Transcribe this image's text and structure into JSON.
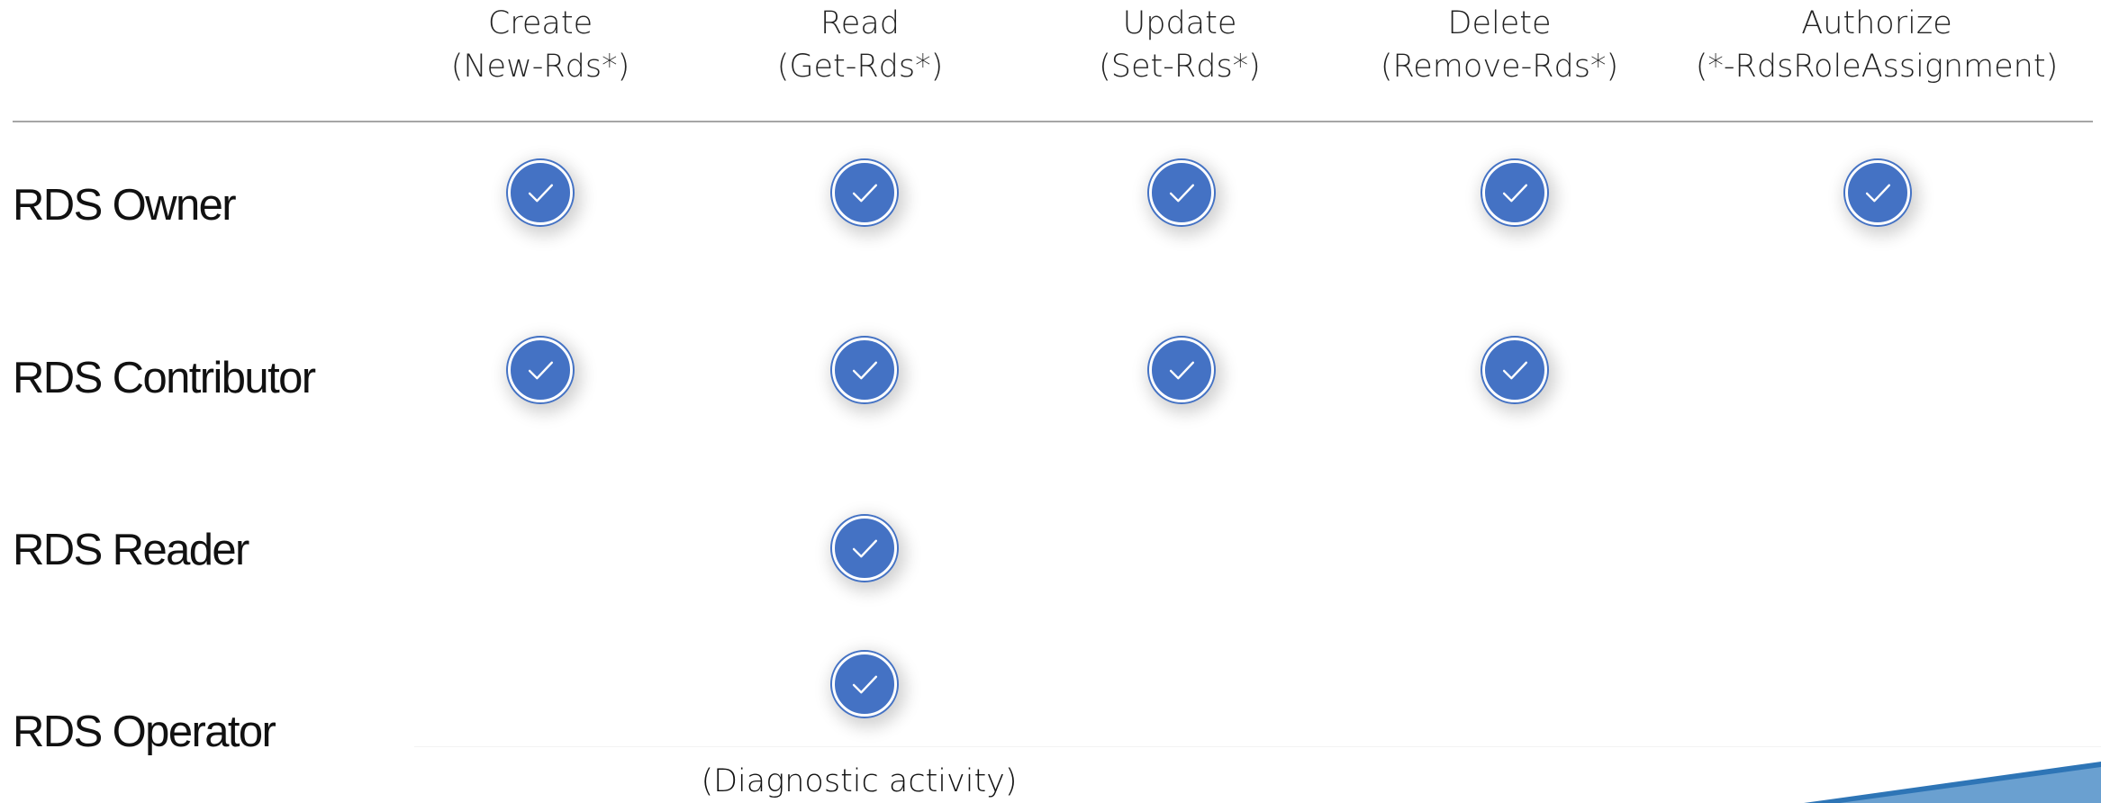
{
  "columns": [
    {
      "title": "Create",
      "subtitle": "(New-Rds*)"
    },
    {
      "title": "Read",
      "subtitle": "(Get-Rds*)"
    },
    {
      "title": "Update",
      "subtitle": "(Set-Rds*)"
    },
    {
      "title": "Delete",
      "subtitle": "(Remove-Rds*)"
    },
    {
      "title": "Authorize",
      "subtitle": "(*-RdsRoleAssignment)"
    }
  ],
  "rows": [
    {
      "label": "RDS Owner",
      "permissions": [
        true,
        true,
        true,
        true,
        true
      ]
    },
    {
      "label": "RDS Contributor",
      "permissions": [
        true,
        true,
        true,
        true,
        false
      ]
    },
    {
      "label": "RDS Reader",
      "permissions": [
        false,
        true,
        false,
        false,
        false
      ]
    },
    {
      "label": "RDS Operator",
      "permissions": [
        false,
        true,
        false,
        false,
        false
      ]
    }
  ],
  "note": "(Diagnostic activity)",
  "colors": {
    "check_fill": "#4472c4",
    "check_border": "#ffffff",
    "rule": "#a6a6a6",
    "accent_corner": "#2e75b6"
  },
  "icons": {
    "permission": "check-circle-icon"
  }
}
